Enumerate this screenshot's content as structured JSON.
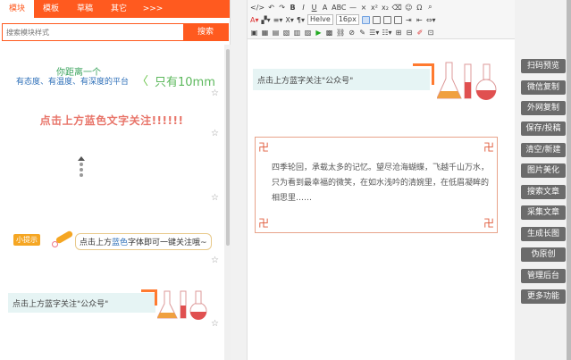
{
  "tabs": [
    "模块",
    "模板",
    "草稿",
    "其它",
    ">>>"
  ],
  "search": {
    "placeholder": "搜索模块样式",
    "button": "搜索"
  },
  "templates": {
    "t1_line1": "你距离一个",
    "t1_line2": "有态度、有温度、有深度的平台",
    "t1_big": "只有10mm",
    "t2": "点击上方蓝色文字关注!!!!!!",
    "tip_tag": "小提示",
    "tip_pre": "点击上方",
    "tip_hl": "蓝色",
    "tip_post": "字体即可一键关注哦~",
    "follow": "点击上方蓝字关注\"公众号\""
  },
  "toolbar": {
    "font": "Helve",
    "size": "16px"
  },
  "editor": {
    "follow": "点击上方蓝字关注\"公众号\"",
    "poem": "四季轮回，承载太多的记忆。望尽沧海蝴蝶，飞越千山万水，只为看到最幸福的微笑，在如水浅吟的清婉里，在低眉凝眸的相思里……"
  },
  "sidebar": [
    "扫码预览",
    "微信复制",
    "外网复制",
    "保存/投稿",
    "清空/新建",
    "图片美化",
    "搜索文章",
    "采集文章",
    "生成长图",
    "伪原创",
    "管理后台",
    "更多功能"
  ]
}
